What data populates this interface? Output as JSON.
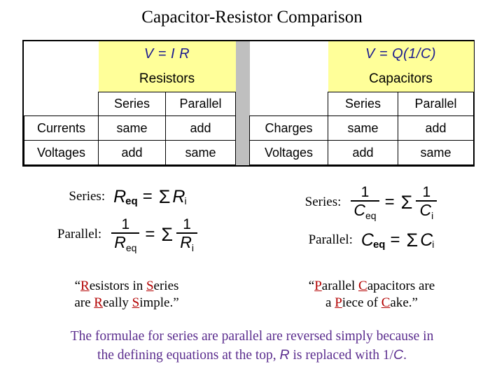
{
  "title": "Capacitor-Resistor Comparison",
  "colors": {
    "highlight": "#ffff99",
    "equation_blue": "#1b1b8f",
    "accent_red": "#b20000",
    "footer_purple": "#5b2d8e",
    "separator_grey": "#bfbfbf"
  },
  "table": {
    "left": {
      "equation": "V = I R",
      "subject": "Resistors",
      "col_headers": [
        "Series",
        "Parallel"
      ],
      "rows": [
        {
          "label": "Currents",
          "series": "same",
          "parallel": "add"
        },
        {
          "label": "Voltages",
          "series": "add",
          "parallel": "same"
        }
      ]
    },
    "right": {
      "equation": "V = Q(1/C)",
      "subject": "Capacitors",
      "col_headers": [
        "Series",
        "Parallel"
      ],
      "rows": [
        {
          "label": "Charges",
          "series": "same",
          "parallel": "add"
        },
        {
          "label": "Voltages",
          "series": "add",
          "parallel": "same"
        }
      ]
    }
  },
  "formulas": {
    "left": {
      "series_label": "Series:",
      "series_lhs_var": "R",
      "series_lhs_sub": "eq",
      "series_equals": "=",
      "series_sigma": "Σ",
      "series_rhs_var": "R",
      "series_rhs_sub": "i",
      "parallel_label": "Parallel:",
      "parallel_num": "1",
      "parallel_lhs_den_var": "R",
      "parallel_lhs_den_sub": "eq",
      "parallel_equals": "=",
      "parallel_sigma": "Σ",
      "parallel_rhs_num": "1",
      "parallel_rhs_den_var": "R",
      "parallel_rhs_den_sub": "i"
    },
    "right": {
      "series_label": "Series:",
      "series_num": "1",
      "series_lhs_den_var": "C",
      "series_lhs_den_sub": "eq",
      "series_equals": "=",
      "series_sigma": "Σ",
      "series_rhs_num": "1",
      "series_rhs_den_var": "C",
      "series_rhs_den_sub": "i",
      "parallel_label": "Parallel:",
      "parallel_lhs_var": "C",
      "parallel_lhs_sub": "eq",
      "parallel_equals": "=",
      "parallel_sigma": "Σ",
      "parallel_rhs_var": "C",
      "parallel_rhs_sub": "i"
    }
  },
  "quotes": {
    "left": {
      "open": "“",
      "l1_a": "R",
      "l1_b": "esistors in ",
      "l1_c": "S",
      "l1_d": "eries",
      "l2_a": "are ",
      "l2_b": "R",
      "l2_c": "eally ",
      "l2_d": "S",
      "l2_e": "imple.”"
    },
    "right": {
      "open": "“",
      "l1_a": "P",
      "l1_b": "arallel ",
      "l1_c": "C",
      "l1_d": "apacitors are",
      "l2_a": "a ",
      "l2_b": "P",
      "l2_c": "iece of ",
      "l2_d": "C",
      "l2_e": "ake.”"
    }
  },
  "footer": {
    "line1": "The formulae for series are parallel are reversed simply because in",
    "line2_a": "the defining equations at the top, ",
    "line2_var1": "R",
    "line2_b": " is replaced with 1/",
    "line2_var2": "C",
    "line2_c": "."
  }
}
